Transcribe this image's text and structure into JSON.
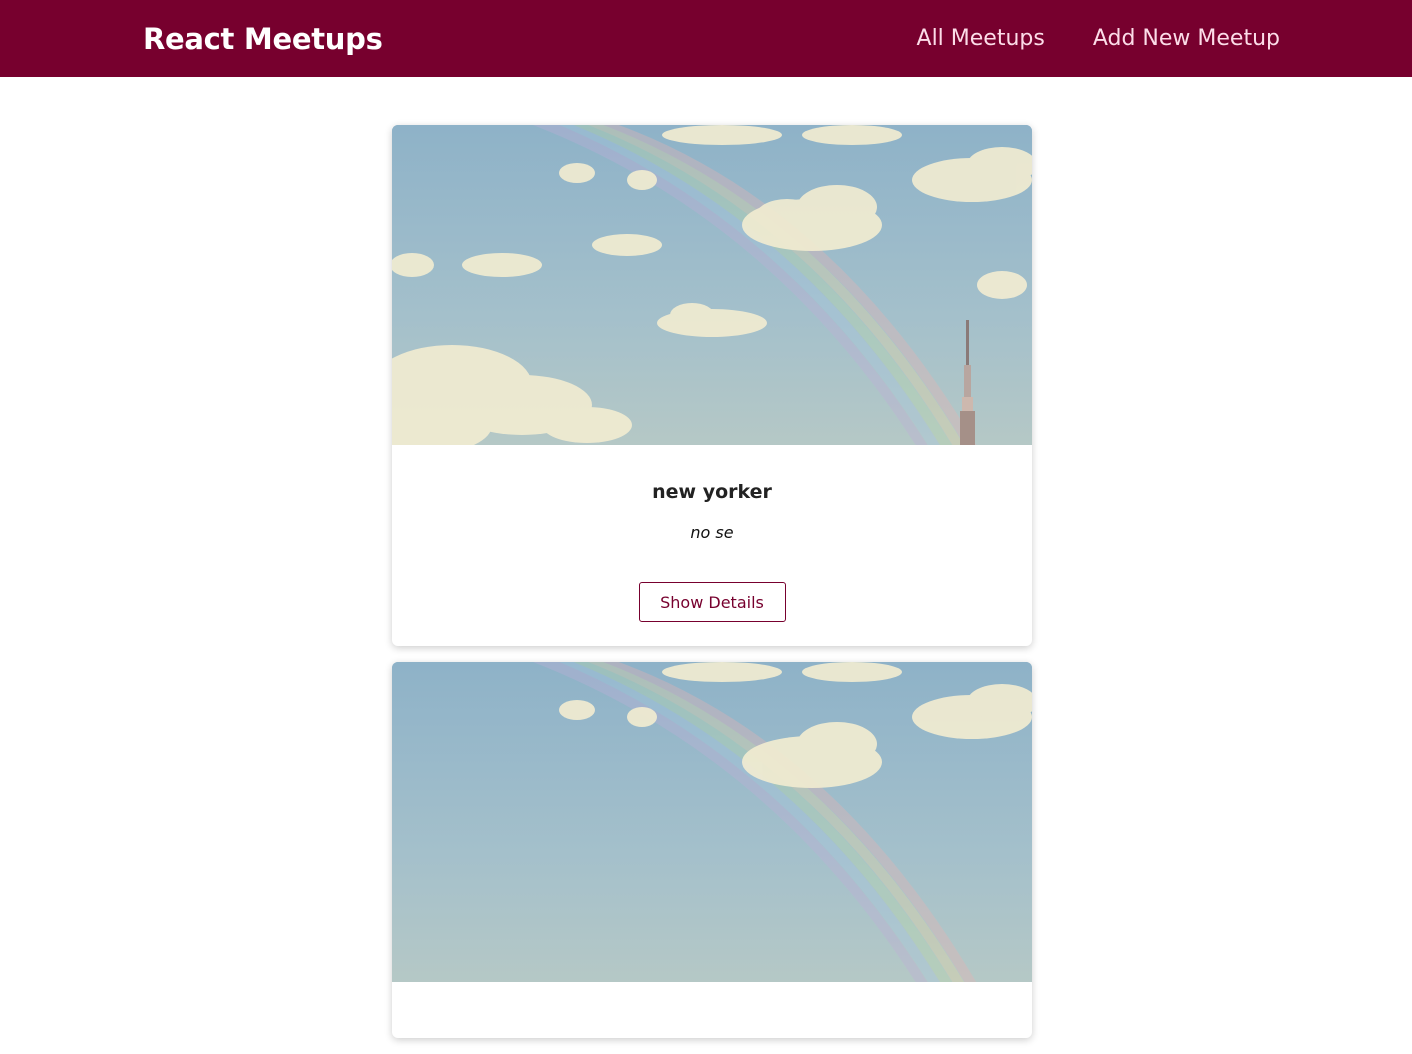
{
  "header": {
    "logo": "React Meetups",
    "nav": {
      "all_meetups": "All Meetups",
      "add_new_meetup": "Add New Meetup"
    }
  },
  "meetups": [
    {
      "title": "new yorker",
      "description": "no se",
      "button_label": "Show Details"
    },
    {
      "title": "",
      "description": "",
      "button_label": ""
    }
  ],
  "colors": {
    "header_bg": "#77002e",
    "nav_text": "#fcdce8",
    "button_accent": "#77002e"
  }
}
